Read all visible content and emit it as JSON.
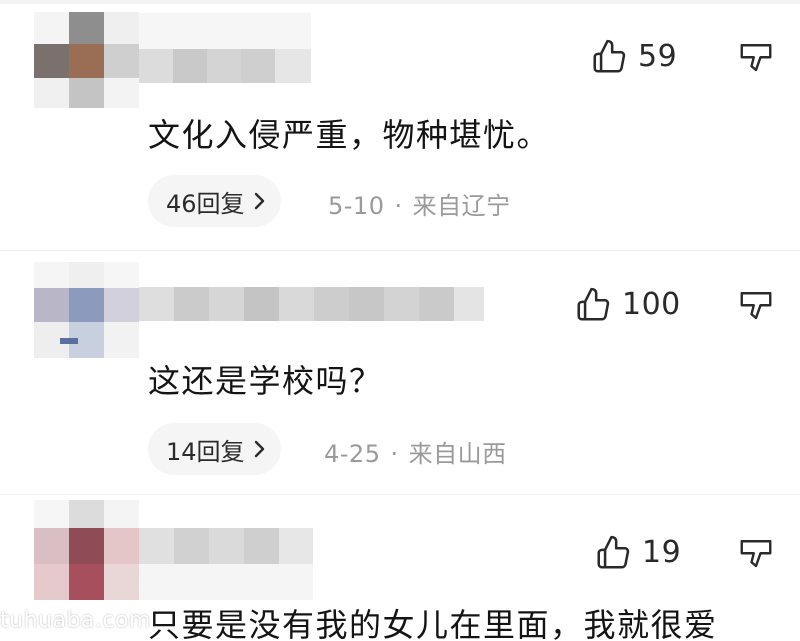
{
  "comments": [
    {
      "like_count": "59",
      "text": "文化入侵严重，物种堪忧。",
      "replies_label": "46回复",
      "date": "5-10",
      "meta_separator": "·",
      "location": "来自辽宁"
    },
    {
      "like_count": "100",
      "text": "这还是学校吗？",
      "replies_label": "14回复",
      "date": "4-25",
      "meta_separator": "·",
      "location": "来自山西"
    },
    {
      "like_count": "19",
      "text": "只要是没有我的女儿在里面，我就很爱"
    }
  ],
  "watermark": "tuhuaba.com",
  "icons": {
    "like": "thumbs-up-outline-icon",
    "dislike": "thumbs-down-outline-icon",
    "chevron": "chevron-right-icon"
  },
  "colors": {
    "text_primary": "#141414",
    "text_meta": "#9a9a9a",
    "pill_bg": "#f5f5f5",
    "icon": "#2a2a2a"
  }
}
